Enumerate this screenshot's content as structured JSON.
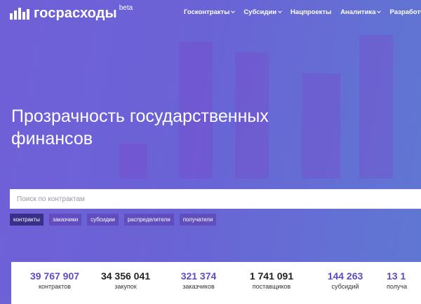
{
  "header": {
    "logo_text": "госрасходы",
    "beta_label": "beta",
    "nav": [
      {
        "label": "Госконтракты",
        "has_dropdown": true
      },
      {
        "label": "Субсидии",
        "has_dropdown": true
      },
      {
        "label": "Нацпроекты",
        "has_dropdown": false
      },
      {
        "label": "Аналитика",
        "has_dropdown": true
      },
      {
        "label": "Разработчикам",
        "has_dropdown": true
      }
    ]
  },
  "hero": {
    "headline_line1": "Прозрачность государственных",
    "headline_line2": "финансов"
  },
  "search": {
    "placeholder": "Поиск по контрактам",
    "value": ""
  },
  "filters": [
    {
      "label": "контракты",
      "active": true
    },
    {
      "label": "заказчики",
      "active": false
    },
    {
      "label": "субсидии",
      "active": false
    },
    {
      "label": "распределители",
      "active": false
    },
    {
      "label": "получатели",
      "active": false
    }
  ],
  "stats": [
    {
      "value": "39 767 907",
      "label": "контрактов",
      "color": "#5b4cc4"
    },
    {
      "value": "34 356 041",
      "label": "закупок",
      "color": "#222222"
    },
    {
      "value": "321 374",
      "label": "заказчиков",
      "color": "#5b4cc4"
    },
    {
      "value": "1 741 091",
      "label": "поставщиков",
      "color": "#222222"
    },
    {
      "value": "144 263",
      "label": "субсидий",
      "color": "#5b4cc4"
    },
    {
      "value": "13 1",
      "label": "получа",
      "color": "#5b4cc4"
    }
  ],
  "colors": {
    "accent": "#5b4cc4",
    "background": "#6e63d4"
  }
}
